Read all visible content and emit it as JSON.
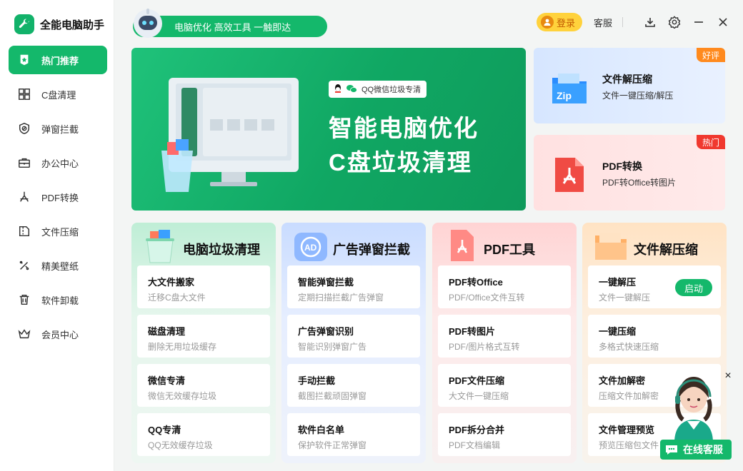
{
  "app": {
    "name": "全能电脑助手",
    "slogan": "电脑优化 高效工具 一触即达"
  },
  "topbar": {
    "login_label": "登录",
    "service_label": "客服",
    "icons": [
      "download-icon",
      "settings-icon",
      "minimize-icon",
      "close-icon"
    ]
  },
  "sidebar": {
    "items": [
      {
        "label": "热门推荐",
        "icon": "hot-icon",
        "active": true
      },
      {
        "label": "C盘清理",
        "icon": "grid-icon"
      },
      {
        "label": "弹窗拦截",
        "icon": "shield-icon"
      },
      {
        "label": "办公中心",
        "icon": "briefcase-icon"
      },
      {
        "label": "PDF转换",
        "icon": "pdf-icon"
      },
      {
        "label": "文件压缩",
        "icon": "zip-icon"
      },
      {
        "label": "精美壁纸",
        "icon": "wallpaper-icon"
      },
      {
        "label": "软件卸载",
        "icon": "trash-icon"
      },
      {
        "label": "会员中心",
        "icon": "crown-icon"
      }
    ]
  },
  "banner": {
    "tag": "QQ微信垃圾专清",
    "title_line1": "智能电脑优化",
    "title_line2": "C盘垃圾清理"
  },
  "side_cards": [
    {
      "title": "文件解压缩",
      "subtitle": "文件一键压缩/解压",
      "badge": "好评",
      "badge_color": "#ff8a1e"
    },
    {
      "title": "PDF转换",
      "subtitle": "PDF转Office转图片",
      "badge": "热门",
      "badge_color": "#f0392f"
    }
  ],
  "columns": [
    {
      "title": "电脑垃圾清理",
      "items": [
        {
          "title": "大文件搬家",
          "subtitle": "迁移C盘大文件"
        },
        {
          "title": "磁盘清理",
          "subtitle": "删除无用垃圾缓存"
        },
        {
          "title": "微信专清",
          "subtitle": "微信无效缓存垃圾"
        },
        {
          "title": "QQ专清",
          "subtitle": "QQ无效缓存垃圾"
        }
      ]
    },
    {
      "title": "广告弹窗拦截",
      "items": [
        {
          "title": "智能弹窗拦截",
          "subtitle": "定期扫描拦截广告弹窗"
        },
        {
          "title": "广告弹窗识别",
          "subtitle": "智能识别弹窗广告"
        },
        {
          "title": "手动拦截",
          "subtitle": "截图拦截顽固弹窗"
        },
        {
          "title": "软件白名单",
          "subtitle": "保护软件正常弹窗"
        }
      ]
    },
    {
      "title": "PDF工具",
      "items": [
        {
          "title": "PDF转Office",
          "subtitle": "PDF/Office文件互转"
        },
        {
          "title": "PDF转图片",
          "subtitle": "PDF/图片格式互转"
        },
        {
          "title": "PDF文件压缩",
          "subtitle": "大文件一键压缩"
        },
        {
          "title": "PDF拆分合并",
          "subtitle": "PDF文档编辑"
        }
      ]
    },
    {
      "title": "文件解压缩",
      "items": [
        {
          "title": "一键解压",
          "subtitle": "文件一键解压",
          "action": "启动"
        },
        {
          "title": "一键压缩",
          "subtitle": "多格式快速压缩"
        },
        {
          "title": "文件加解密",
          "subtitle": "压缩文件加解密"
        },
        {
          "title": "文件管理预览",
          "subtitle": "预览压缩包文件"
        }
      ]
    }
  ],
  "service_widget": {
    "button_label": "在线客服"
  },
  "colors": {
    "brand_green": "#14b86b",
    "login_yellow": "#ffd23c"
  }
}
